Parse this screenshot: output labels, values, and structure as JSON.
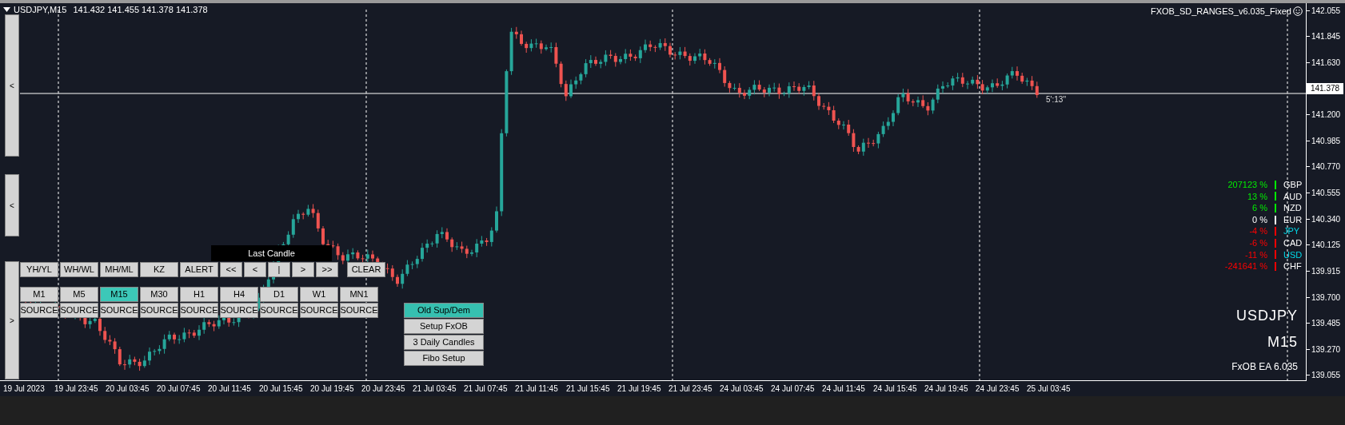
{
  "header": {
    "symbol": "USDJPY,M15",
    "quote": "141.432 141.455 141.378 141.378"
  },
  "indicator": {
    "name": "FXOB_SD_RANGES_v6.035_Fixed"
  },
  "countdown": "5':13''",
  "side_buttons": [
    {
      "label": "<"
    },
    {
      "label": "<"
    },
    {
      "label": ">"
    }
  ],
  "last_candle": {
    "title": "Last Candle"
  },
  "tool_buttons": [
    {
      "label": "YH/YL"
    },
    {
      "label": "WH/WL"
    },
    {
      "label": "MH/ML"
    },
    {
      "label": "KZ"
    },
    {
      "label": "ALERT"
    },
    {
      "label": "<<"
    },
    {
      "label": "<"
    },
    {
      "label": "|"
    },
    {
      "label": ">"
    },
    {
      "label": ">>"
    }
  ],
  "clear_button": {
    "label": "CLEAR"
  },
  "timeframes": [
    {
      "label": "M1",
      "selected": false,
      "source": "SOURCE"
    },
    {
      "label": "M5",
      "selected": false,
      "source": "SOURCE"
    },
    {
      "label": "M15",
      "selected": true,
      "source": "SOURCE"
    },
    {
      "label": "M30",
      "selected": false,
      "source": "SOURCE"
    },
    {
      "label": "H1",
      "selected": false,
      "source": "SOURCE"
    },
    {
      "label": "H4",
      "selected": false,
      "source": "SOURCE"
    },
    {
      "label": "D1",
      "selected": false,
      "source": "SOURCE"
    },
    {
      "label": "W1",
      "selected": false,
      "source": "SOURCE"
    },
    {
      "label": "MN1",
      "selected": false,
      "source": "SOURCE"
    }
  ],
  "menu_buttons": [
    {
      "label": "Old Sup/Dem",
      "selected": true
    },
    {
      "label": "Setup FxOB",
      "selected": false
    },
    {
      "label": "3 Daily Candles",
      "selected": false
    },
    {
      "label": "Fibo Setup",
      "selected": false
    }
  ],
  "currency_strength": [
    {
      "value": "207123 %",
      "currency": "GBP",
      "color": "#00ee00",
      "highlight": false
    },
    {
      "value": "13 %",
      "currency": "AUD",
      "color": "#00ee00",
      "highlight": false
    },
    {
      "value": "6 %",
      "currency": "NZD",
      "color": "#00ee00",
      "highlight": false
    },
    {
      "value": "0 %",
      "currency": "EUR",
      "color": "#ffffff",
      "highlight": false
    },
    {
      "value": "-4 %",
      "currency": "JPY",
      "color": "#ff0000",
      "highlight": true
    },
    {
      "value": "-6 %",
      "currency": "CAD",
      "color": "#ff0000",
      "highlight": false
    },
    {
      "value": "-11 %",
      "currency": "USD",
      "color": "#ff0000",
      "highlight": true
    },
    {
      "value": "-241641 %",
      "currency": "CHF",
      "color": "#ff0000",
      "highlight": false
    }
  ],
  "overlay": {
    "symbol": "USDJPY",
    "timeframe": "M15",
    "version": "FxOB EA 6.035"
  },
  "price_axis": [
    "142.055",
    "141.845",
    "141.630",
    "141.200",
    "140.985",
    "140.770",
    "140.555",
    "140.340",
    "140.125",
    "139.915",
    "139.700",
    "139.485",
    "139.270",
    "139.055"
  ],
  "current_price": "141.378",
  "time_axis": [
    "19 Jul 2023",
    "19 Jul 23:45",
    "20 Jul 03:45",
    "20 Jul 07:45",
    "20 Jul 11:45",
    "20 Jul 15:45",
    "20 Jul 19:45",
    "20 Jul 23:45",
    "21 Jul 03:45",
    "21 Jul 07:45",
    "21 Jul 11:45",
    "21 Jul 15:45",
    "21 Jul 19:45",
    "21 Jul 23:45",
    "24 Jul 03:45",
    "24 Jul 07:45",
    "24 Jul 11:45",
    "24 Jul 15:45",
    "24 Jul 19:45",
    "24 Jul 23:45",
    "25 Jul 03:45"
  ]
}
